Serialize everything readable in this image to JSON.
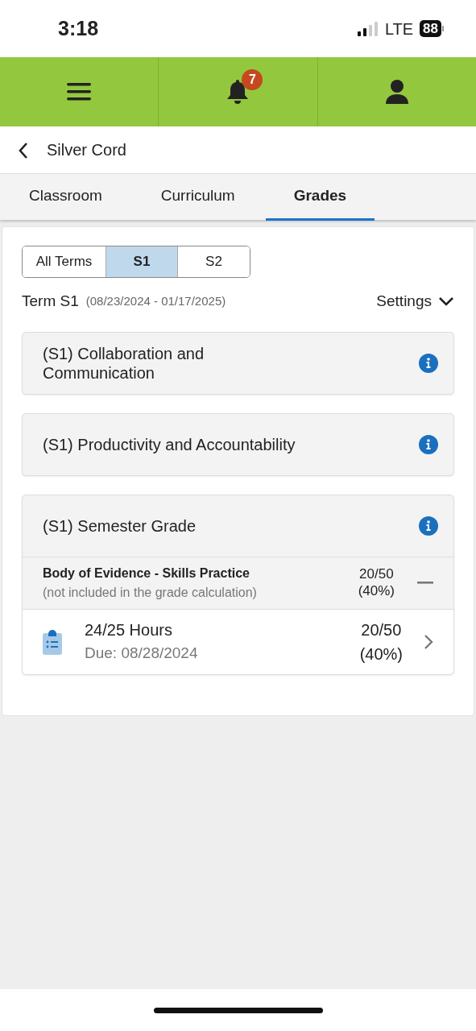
{
  "status_bar": {
    "time": "3:18",
    "network": "LTE",
    "battery": "88"
  },
  "nav": {
    "notification_count": "7"
  },
  "header": {
    "title": "Silver Cord"
  },
  "tabs": [
    {
      "label": "Classroom",
      "selected": false
    },
    {
      "label": "Curriculum",
      "selected": false
    },
    {
      "label": "Grades",
      "selected": true
    }
  ],
  "terms": [
    {
      "label": "All Terms",
      "selected": false
    },
    {
      "label": "S1",
      "selected": true
    },
    {
      "label": "S2",
      "selected": false
    }
  ],
  "term": {
    "name": "Term S1",
    "dates": "(08/23/2024 - 01/17/2025)"
  },
  "settings": {
    "label": "Settings"
  },
  "categories": [
    {
      "title": "(S1) Collaboration and Communication"
    },
    {
      "title": "(S1) Productivity and Accountability"
    },
    {
      "title": "(S1) Semester Grade",
      "groups": [
        {
          "title": "Body of Evidence - Skills Practice",
          "note": "(not included in the grade calculation)",
          "score": "20/50",
          "percent": "(40%)",
          "items": [
            {
              "title": "24/25 Hours",
              "due": "Due: 08/28/2024",
              "score": "20/50",
              "percent": "(40%)"
            }
          ]
        }
      ]
    }
  ]
}
